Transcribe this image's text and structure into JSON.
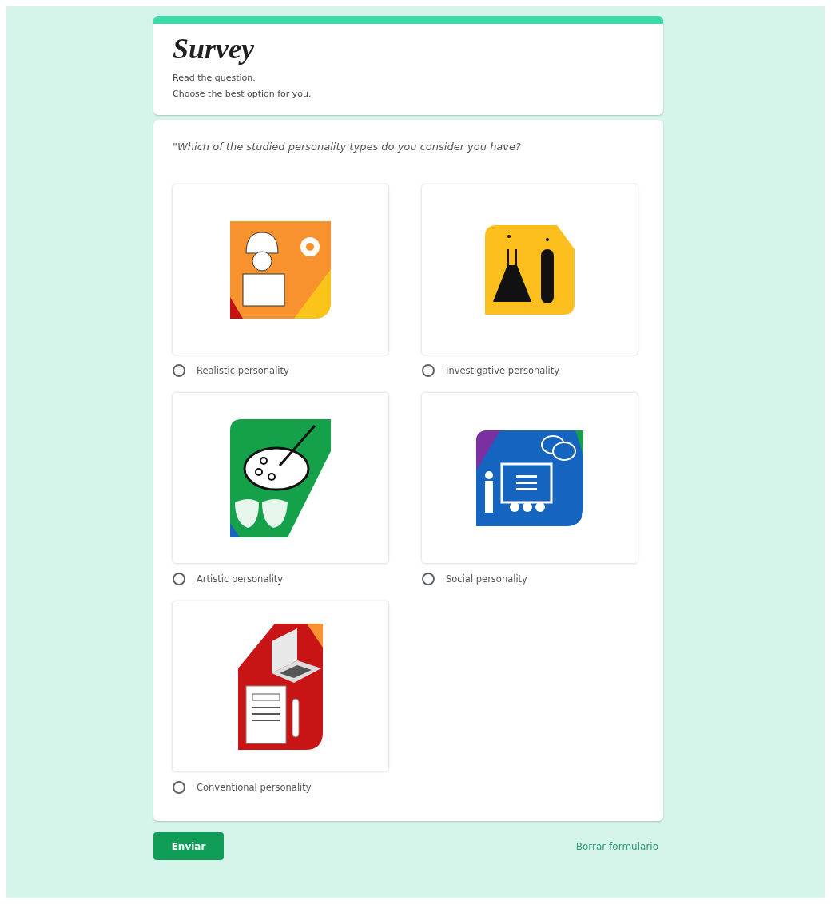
{
  "header": {
    "title": "Survey",
    "description": [
      "Read the question.",
      "Choose the best option for you."
    ]
  },
  "question": {
    "text": "\"Which of the studied personality types do you consider you have?",
    "options": [
      {
        "label": "Realistic personality",
        "kind": "engineer",
        "selected": false
      },
      {
        "label": "Investigative personality",
        "kind": "lab",
        "selected": false
      },
      {
        "label": "Artistic personality",
        "kind": "art",
        "selected": false
      },
      {
        "label": "Social personality",
        "kind": "teacher",
        "selected": false
      },
      {
        "label": "Conventional personality",
        "kind": "office",
        "selected": false
      }
    ]
  },
  "footer": {
    "submit": "Enviar",
    "clear": "Borrar formulario"
  }
}
